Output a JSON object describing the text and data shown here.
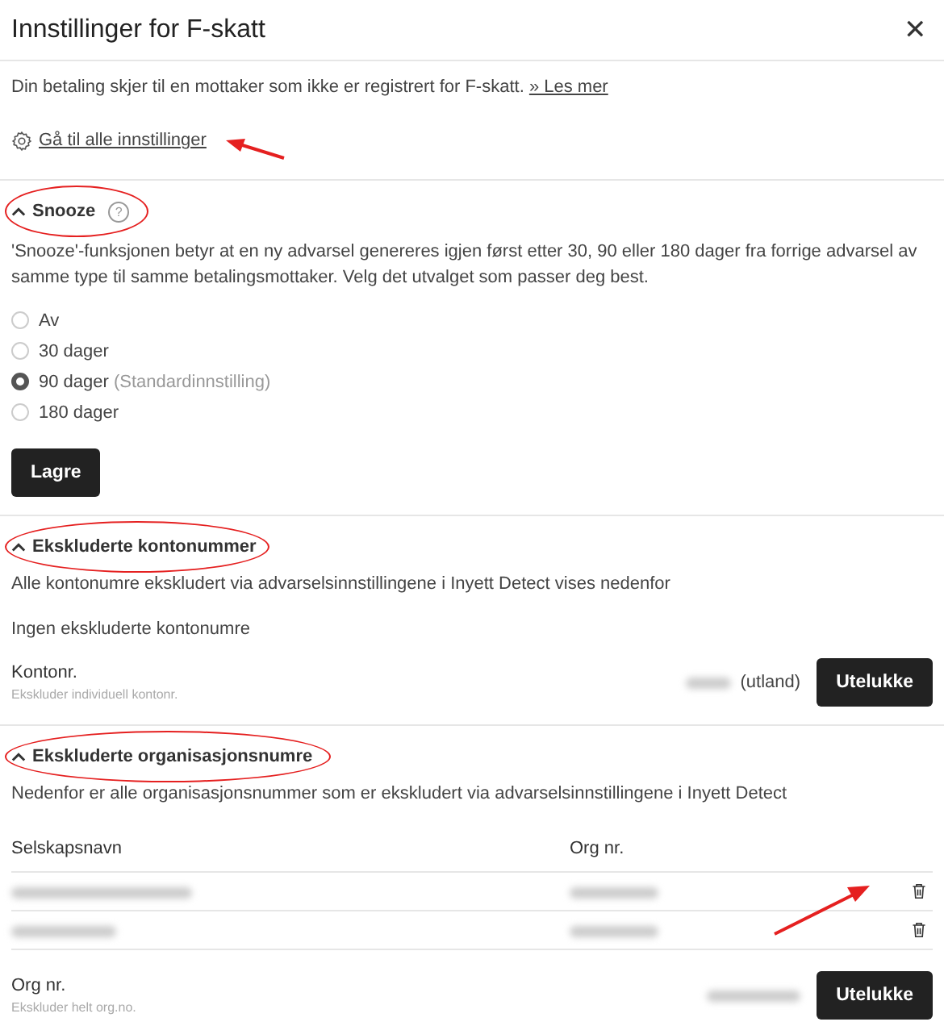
{
  "dialog": {
    "title": "Innstillinger for F-skatt",
    "close": "✕"
  },
  "intro": {
    "text": "Din betaling skjer til en mottaker som ikke er registrert for F-skatt.",
    "link": "» Les mer"
  },
  "settings_link": {
    "label": "Gå til alle innstillinger",
    "annotated": true
  },
  "snooze": {
    "title": "Snooze",
    "expanded": true,
    "highlighted": true,
    "help": "?",
    "description": "'Snooze'-funksjonen betyr at en ny advarsel genereres igjen først etter 30, 90 eller 180 dager fra forrige advarsel av samme type til samme betalingsmottaker. Velg det utvalget som passer deg best.",
    "options": [
      {
        "label": "Av",
        "selected": false
      },
      {
        "label": "30 dager",
        "selected": false
      },
      {
        "label": "90 dager",
        "note": "(Standardinnstilling)",
        "selected": true
      },
      {
        "label": "180 dager",
        "selected": false
      }
    ],
    "button": "Lagre"
  },
  "accounts": {
    "title": "Ekskluderte kontonummer",
    "expanded": true,
    "highlighted": true,
    "description": "Alle kontonumre ekskludert via advarselsinnstillingene i Inyett Detect vises nedenfor",
    "empty": "Ingen ekskluderte kontonumre",
    "field_label": "Kontonr.",
    "field_hint": "Ekskluder individuell kontonr.",
    "field_suffix": "(utland)",
    "button": "Utelukke"
  },
  "orgs": {
    "title": "Ekskluderte organisasjonsnumre",
    "expanded": true,
    "highlighted": true,
    "description": "Nedenfor er alle organisasjonsnummer som er ekskludert via advarselsinnstillingene i Inyett Detect",
    "columns": [
      "Selskapsnavn",
      "Org nr."
    ],
    "rows": [
      {
        "annotated": true
      },
      {
        "annotated": false
      }
    ],
    "field_label": "Org nr.",
    "field_hint": "Ekskluder helt org.no.",
    "button": "Utelukke"
  }
}
